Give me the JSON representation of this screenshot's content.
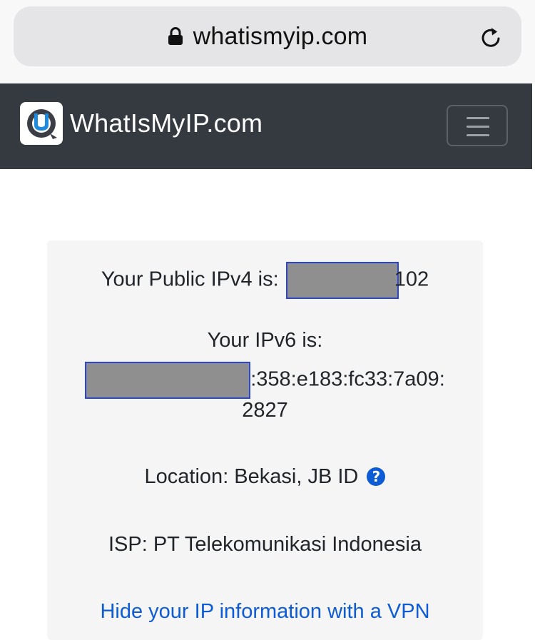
{
  "browser": {
    "url": "whatismyip.com",
    "lock_icon": "lock-icon",
    "reload_icon": "reload-icon"
  },
  "navbar": {
    "brand": "WhatIsMyIP.com",
    "logo_icon": "whatismyip-logo-icon",
    "menu_icon": "hamburger-menu-icon",
    "background_color": "#343a40"
  },
  "ip_info": {
    "ipv4_label": "Your Public IPv4 is:",
    "ipv4_suffix": "102",
    "ipv6_label": "Your IPv6 is:",
    "ipv6_suffix": ":358:e183:fc33:7a09:",
    "ipv6_last": "2827",
    "location": "Location: Bekasi, JB ID",
    "location_help_icon": "question-circle-icon",
    "isp": "ISP: PT Telekomunikasi Indonesia",
    "vpn_link": "Hide your IP information with a VPN",
    "link_color": "#0d5cd6"
  }
}
